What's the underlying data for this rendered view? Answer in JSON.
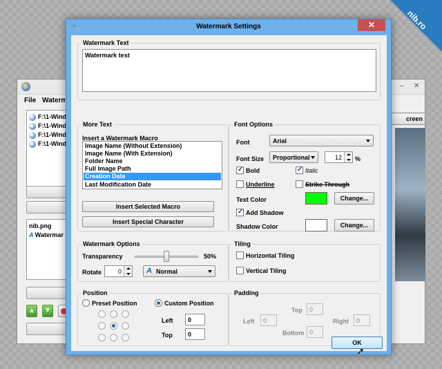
{
  "background_window": {
    "menu": [
      "File",
      "Watermar"
    ],
    "tree_items": [
      "F:\\1-Wind",
      "F:\\1-Wind",
      "F:\\1-Wind",
      "F:\\1-Wind"
    ],
    "list_items": [
      "nib.png",
      "Watermar"
    ],
    "screen_button": "creen",
    "minimize": "–",
    "close": "✕"
  },
  "brand": {
    "text": "nib.ro"
  },
  "dialog": {
    "title": "Watermark Settings",
    "close_label": "✕",
    "ok_label": "OK"
  },
  "watermark_text": {
    "group_title": "Watermark Text",
    "value": "Watermark test"
  },
  "more_text": {
    "group_title": "More Text",
    "macro_label": "Insert a Watermark Macro",
    "macros": [
      "Image Name (Without Extension)",
      "Image Name (With Extension)",
      "Folder Name",
      "Full Image Path",
      "Creation Date",
      "Last Modification Date"
    ],
    "selected_macro": "Creation Date",
    "insert_macro_button": "Insert Selected Macro",
    "insert_char_button": "Insert Special Character"
  },
  "font_options": {
    "group_title": "Font Options",
    "font_label": "Font",
    "font_value": "Arial",
    "size_label": "Font Size",
    "size_mode": "Proportional",
    "size_value": "12",
    "size_unit": "%",
    "bold_label": "Bold",
    "bold_checked": true,
    "italic_label": "Italic",
    "italic_checked": true,
    "underline_label": "Underline",
    "underline_checked": false,
    "strike_label": "Strike Through",
    "strike_checked": false,
    "text_color_label": "Text Color",
    "text_color": "#00ff00",
    "change_label": "Change...",
    "add_shadow_label": "Add Shadow",
    "add_shadow_checked": true,
    "shadow_color_label": "Shadow Color",
    "shadow_color": "#ffffff"
  },
  "watermark_options": {
    "group_title": "Watermark Options",
    "transparency_label": "Transparency",
    "transparency_value": "50%",
    "transparency_fraction": 0.5,
    "rotate_label": "Rotate",
    "rotate_value": "0",
    "rotate_mode": "Normal"
  },
  "tiling": {
    "group_title": "Tiling",
    "horizontal_label": "Horizontal Tiling",
    "vertical_label": "Vertical Tiling"
  },
  "position": {
    "group_title": "Position",
    "preset_label": "Preset Position",
    "custom_label": "Custom Position",
    "mode": "custom",
    "left_label": "Left",
    "left_value": "0",
    "top_label": "Top",
    "top_value": "0"
  },
  "padding": {
    "group_title": "Padding",
    "top_label": "Top",
    "top_value": "0",
    "left_label": "Left",
    "left_value": "0",
    "right_label": "Right",
    "right_value": "0",
    "bottom_label": "Bottom",
    "bottom_value": "0"
  },
  "colors": {
    "dialog_frame": "#6db0ec",
    "close_button": "#c75050",
    "selection": "#3399ff",
    "brand": "#2a7cc0"
  }
}
